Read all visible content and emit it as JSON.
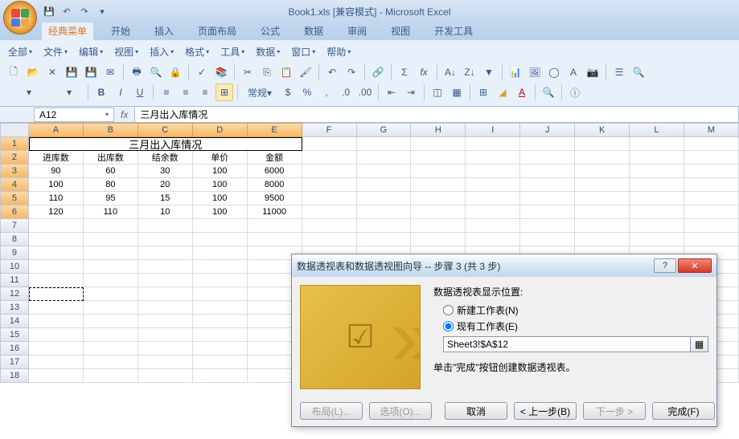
{
  "title": "Book1.xls  [兼容模式] - Microsoft Excel",
  "tabs": [
    "经典菜单",
    "开始",
    "插入",
    "页面布局",
    "公式",
    "数据",
    "审阅",
    "视图",
    "开发工具"
  ],
  "active_tab": 0,
  "menus": [
    "全部",
    "文件",
    "编辑",
    "视图",
    "插入",
    "格式",
    "工具",
    "数据",
    "窗口",
    "帮助"
  ],
  "namebox": "A12",
  "formula": "三月出入库情况",
  "columns": [
    "A",
    "B",
    "C",
    "D",
    "E",
    "F",
    "G",
    "H",
    "I",
    "J",
    "K",
    "L",
    "M"
  ],
  "row_count": 18,
  "merged_title": "三月出入库情况",
  "headers": [
    "进库数",
    "出库数",
    "结余数",
    "单价",
    "金额"
  ],
  "table": [
    [
      "90",
      "60",
      "30",
      "100",
      "6000"
    ],
    [
      "100",
      "80",
      "20",
      "100",
      "8000"
    ],
    [
      "110",
      "95",
      "15",
      "100",
      "9500"
    ],
    [
      "120",
      "110",
      "10",
      "100",
      "11000"
    ]
  ],
  "selected_columns": [
    "A",
    "B",
    "C",
    "D",
    "E"
  ],
  "selected_rows": [
    1,
    2,
    3,
    4,
    5,
    6
  ],
  "dialog": {
    "title": "数据透视表和数据透视图向导 -- 步骤 3 (共 3 步)",
    "section": "数据透视表显示位置:",
    "opt_new": "新建工作表(N)",
    "opt_new_key": "N",
    "opt_existing": "现有工作表(E)",
    "opt_existing_key": "E",
    "selected": "existing",
    "ref": "Sheet3!$A$12",
    "hint": "单击\"完成\"按钮创建数据透视表。",
    "btn_layout": "布局(L)...",
    "btn_options": "选项(O)...",
    "btn_cancel": "取消",
    "btn_back": "< 上一步(B)",
    "btn_next": "下一步 >",
    "btn_finish": "完成(F)"
  }
}
